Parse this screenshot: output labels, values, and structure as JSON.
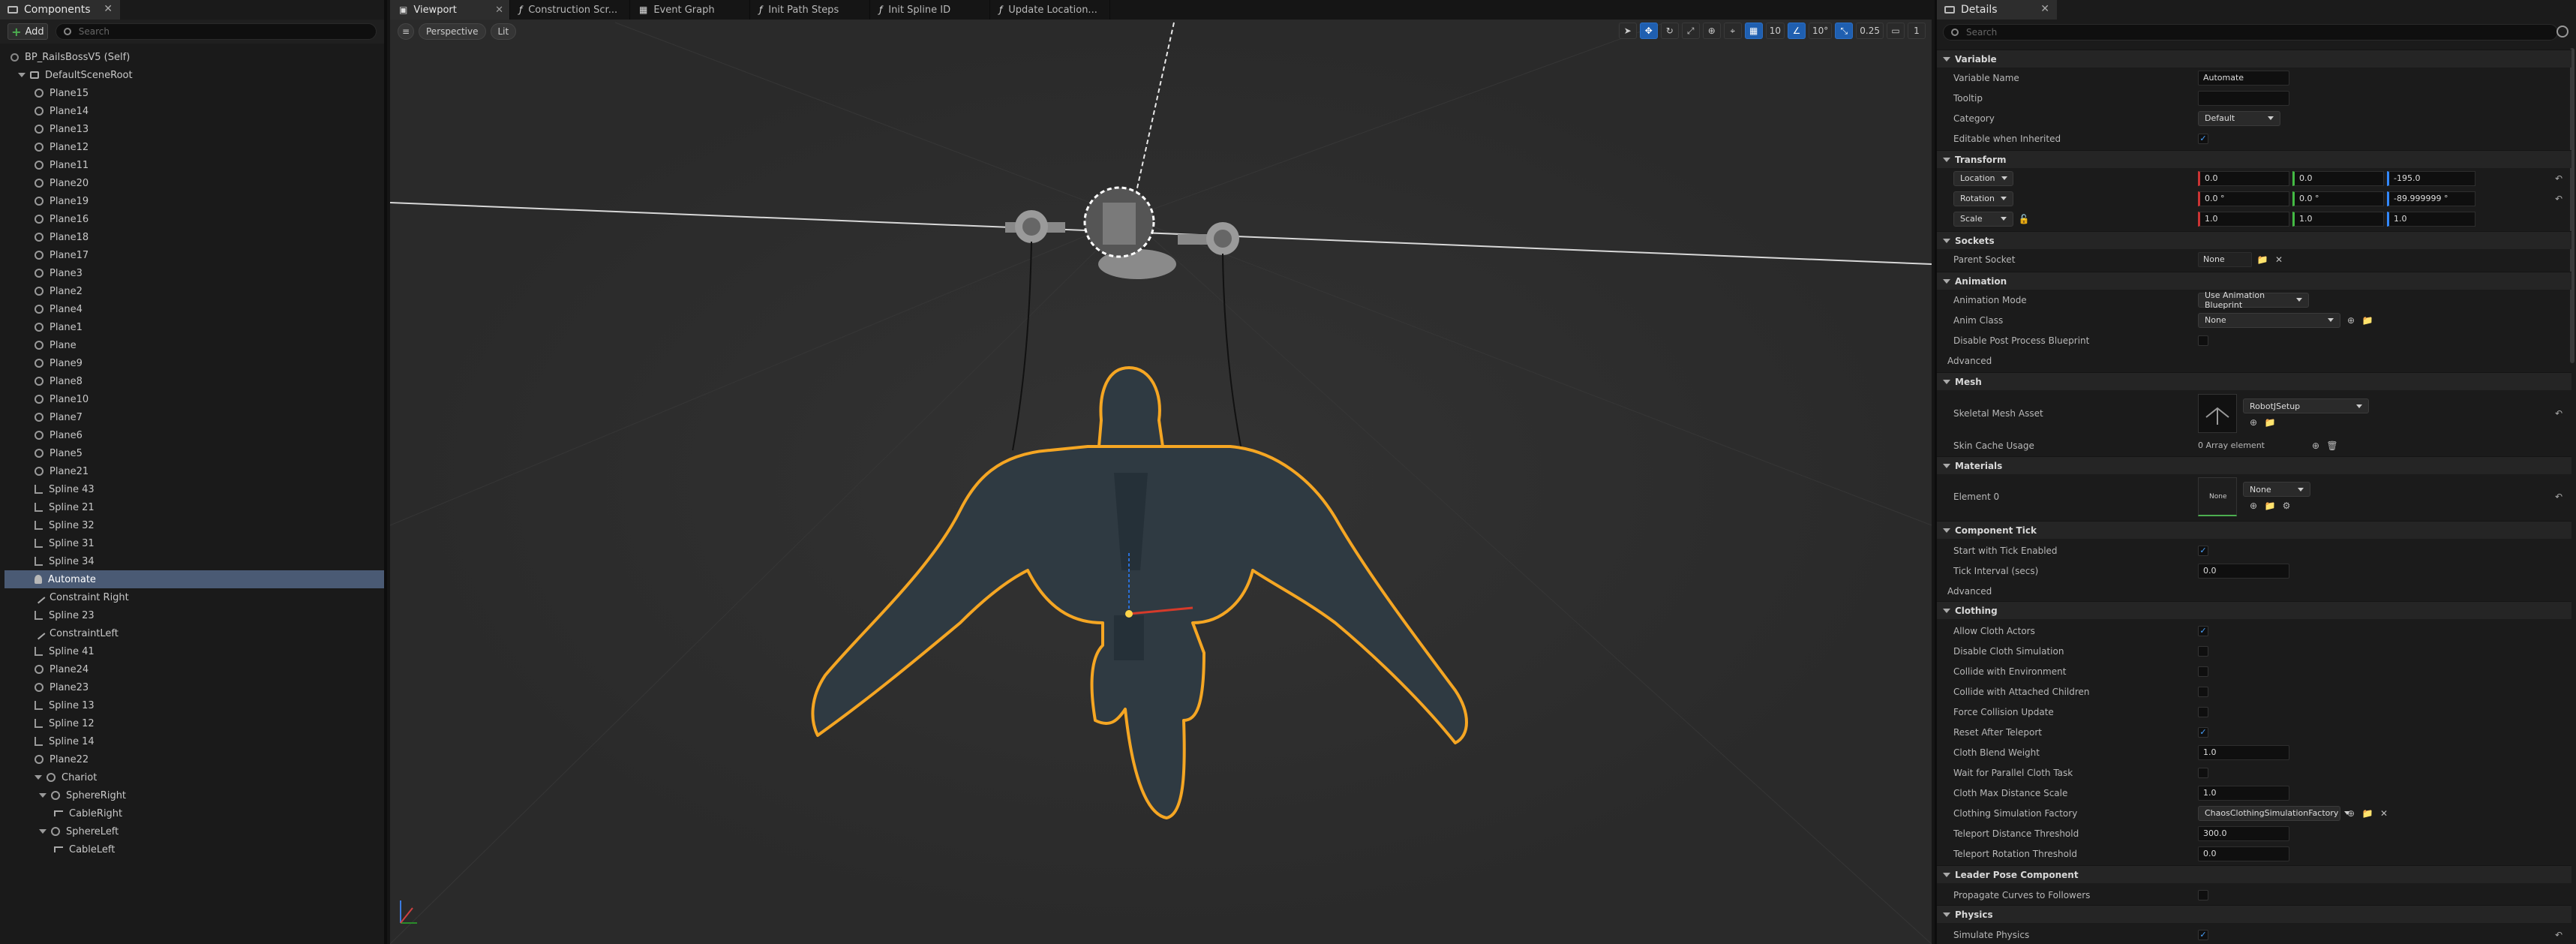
{
  "left": {
    "tab": "Components",
    "add_label": "Add",
    "search_placeholder": "Search",
    "tree": [
      {
        "label": "BP_RailsBossV5 (Self)",
        "icon": "self-icon",
        "level": 0
      },
      {
        "label": "DefaultSceneRoot",
        "icon": "scene-root-icon",
        "level": 1,
        "expanded": true
      },
      {
        "label": "Plane15",
        "icon": "mesh-icon",
        "level": 2
      },
      {
        "label": "Plane14",
        "icon": "mesh-icon",
        "level": 2
      },
      {
        "label": "Plane13",
        "icon": "mesh-icon",
        "level": 2
      },
      {
        "label": "Plane12",
        "icon": "mesh-icon",
        "level": 2
      },
      {
        "label": "Plane11",
        "icon": "mesh-icon",
        "level": 2
      },
      {
        "label": "Plane20",
        "icon": "mesh-icon",
        "level": 2
      },
      {
        "label": "Plane19",
        "icon": "mesh-icon",
        "level": 2
      },
      {
        "label": "Plane16",
        "icon": "mesh-icon",
        "level": 2
      },
      {
        "label": "Plane18",
        "icon": "mesh-icon",
        "level": 2
      },
      {
        "label": "Plane17",
        "icon": "mesh-icon",
        "level": 2
      },
      {
        "label": "Plane3",
        "icon": "mesh-icon",
        "level": 2
      },
      {
        "label": "Plane2",
        "icon": "mesh-icon",
        "level": 2
      },
      {
        "label": "Plane4",
        "icon": "mesh-icon",
        "level": 2
      },
      {
        "label": "Plane1",
        "icon": "mesh-icon",
        "level": 2
      },
      {
        "label": "Plane",
        "icon": "mesh-icon",
        "level": 2
      },
      {
        "label": "Plane9",
        "icon": "mesh-icon",
        "level": 2
      },
      {
        "label": "Plane8",
        "icon": "mesh-icon",
        "level": 2
      },
      {
        "label": "Plane10",
        "icon": "mesh-icon",
        "level": 2
      },
      {
        "label": "Plane7",
        "icon": "mesh-icon",
        "level": 2
      },
      {
        "label": "Plane6",
        "icon": "mesh-icon",
        "level": 2
      },
      {
        "label": "Plane5",
        "icon": "mesh-icon",
        "level": 2
      },
      {
        "label": "Plane21",
        "icon": "mesh-icon",
        "level": 2
      },
      {
        "label": "Spline 43",
        "icon": "spline-icon",
        "level": 2
      },
      {
        "label": "Spline 21",
        "icon": "spline-icon",
        "level": 2
      },
      {
        "label": "Spline 32",
        "icon": "spline-icon",
        "level": 2
      },
      {
        "label": "Spline 31",
        "icon": "spline-icon",
        "level": 2
      },
      {
        "label": "Spline 34",
        "icon": "spline-icon",
        "level": 2
      },
      {
        "label": "Automate",
        "icon": "skeletal-mesh-icon",
        "level": 2,
        "selected": true
      },
      {
        "label": "Constraint Right",
        "icon": "constraint-icon",
        "level": 2
      },
      {
        "label": "Spline 23",
        "icon": "spline-icon",
        "level": 2
      },
      {
        "label": "ConstraintLeft",
        "icon": "constraint-icon",
        "level": 2
      },
      {
        "label": "Spline 41",
        "icon": "spline-icon",
        "level": 2
      },
      {
        "label": "Plane24",
        "icon": "mesh-icon",
        "level": 2
      },
      {
        "label": "Plane23",
        "icon": "mesh-icon",
        "level": 2
      },
      {
        "label": "Spline 13",
        "icon": "spline-icon",
        "level": 2
      },
      {
        "label": "Spline 12",
        "icon": "spline-icon",
        "level": 2
      },
      {
        "label": "Spline 14",
        "icon": "spline-icon",
        "level": 2
      },
      {
        "label": "Plane22",
        "icon": "mesh-icon",
        "level": 2
      },
      {
        "label": "Chariot",
        "icon": "mesh-icon",
        "level": 2,
        "expanded": true
      },
      {
        "label": "SphereRight",
        "icon": "mesh-icon",
        "level": 3,
        "expanded": true
      },
      {
        "label": "CableRight",
        "icon": "cable-icon",
        "level": 4
      },
      {
        "label": "SphereLeft",
        "icon": "mesh-icon",
        "level": 3,
        "expanded": true
      },
      {
        "label": "CableLeft",
        "icon": "cable-icon",
        "level": 4
      }
    ]
  },
  "viewport": {
    "tabs": [
      {
        "label": "Viewport",
        "active": true
      },
      {
        "label": "Construction Scr..."
      },
      {
        "label": "Event Graph"
      },
      {
        "label": "Init Path Steps"
      },
      {
        "label": "Init Spline ID"
      },
      {
        "label": "Update Location..."
      }
    ],
    "perspective": "Perspective",
    "lit": "Lit",
    "grid_snap": "10",
    "rotation_snap": "10°",
    "scale_snap": "0.25",
    "camera_speed": "1"
  },
  "details": {
    "tab": "Details",
    "search_placeholder": "Search",
    "variable": {
      "section": "Variable",
      "name_label": "Variable Name",
      "name_value": "Automate",
      "tooltip_label": "Tooltip",
      "category_label": "Category",
      "category_value": "Default",
      "editable_label": "Editable when Inherited"
    },
    "transform": {
      "section": "Transform",
      "location_label": "Location",
      "rotation_label": "Rotation",
      "scale_label": "Scale",
      "location": [
        "0.0",
        "0.0",
        "-195.0"
      ],
      "rotation": [
        "0.0 °",
        "0.0 °",
        "-89.999999 °"
      ],
      "scale": [
        "1.0",
        "1.0",
        "1.0"
      ]
    },
    "sockets": {
      "section": "Sockets",
      "parent_label": "Parent Socket",
      "parent_value": "None"
    },
    "animation": {
      "section": "Animation",
      "mode_label": "Animation Mode",
      "mode_value": "Use Animation Blueprint",
      "class_label": "Anim Class",
      "class_value": "None",
      "disable_pp_label": "Disable Post Process Blueprint",
      "advanced": "Advanced"
    },
    "mesh": {
      "section": "Mesh",
      "asset_label": "Skeletal Mesh Asset",
      "asset_value": "RobotJSetup",
      "skin_label": "Skin Cache Usage",
      "skin_value": "0 Array element"
    },
    "materials": {
      "section": "Materials",
      "element_label": "Element 0",
      "element_value": "None",
      "thumb_text": "None"
    },
    "tick": {
      "section": "Component Tick",
      "start_label": "Start with Tick Enabled",
      "interval_label": "Tick Interval (secs)",
      "interval_value": "0.0",
      "advanced": "Advanced"
    },
    "clothing": {
      "section": "Clothing",
      "items": [
        {
          "label": "Allow Cloth Actors",
          "type": "check",
          "checked": true
        },
        {
          "label": "Disable Cloth Simulation",
          "type": "check",
          "checked": false
        },
        {
          "label": "Collide with Environment",
          "type": "check",
          "checked": false
        },
        {
          "label": "Collide with Attached Children",
          "type": "check",
          "checked": false
        },
        {
          "label": "Force Collision Update",
          "type": "check",
          "checked": false
        },
        {
          "label": "Reset After Teleport",
          "type": "check",
          "checked": true
        },
        {
          "label": "Cloth Blend Weight",
          "type": "field",
          "value": "1.0"
        },
        {
          "label": "Wait for Parallel Cloth Task",
          "type": "check",
          "checked": false
        },
        {
          "label": "Cloth Max Distance Scale",
          "type": "field",
          "value": "1.0"
        },
        {
          "label": "Clothing Simulation Factory",
          "type": "combo",
          "value": "ChaosClothingSimulationFactory"
        },
        {
          "label": "Teleport Distance Threshold",
          "type": "field",
          "value": "300.0"
        },
        {
          "label": "Teleport Rotation Threshold",
          "type": "field",
          "value": "0.0"
        }
      ]
    },
    "leader": {
      "section": "Leader Pose Component",
      "propagate_label": "Propagate Curves to Followers"
    },
    "physics": {
      "section": "Physics",
      "simulate_label": "Simulate Physics"
    }
  },
  "colors": {
    "selection": "#4a5a74",
    "outline": "#f5a623",
    "accent": "#1f5fb0"
  }
}
